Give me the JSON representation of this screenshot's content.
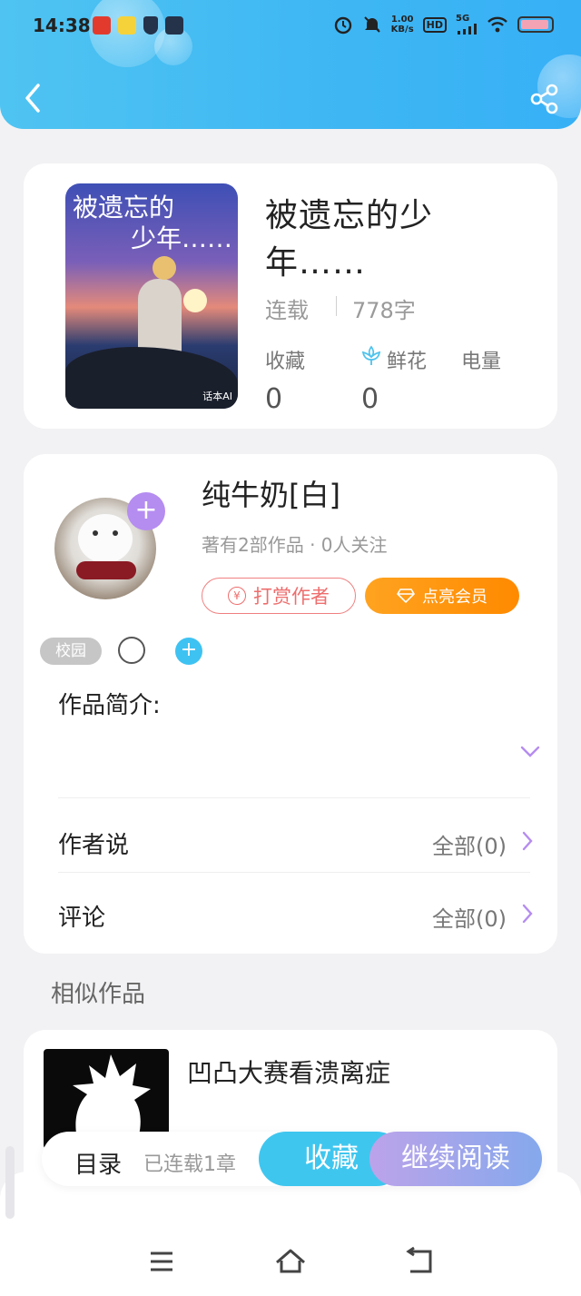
{
  "status_bar": {
    "time": "14:38",
    "net_speed_top": "1.00",
    "net_speed_unit": "KB/s",
    "hd": "HD",
    "signal": "5G"
  },
  "book": {
    "cover_title_line1": "被遗忘的",
    "cover_title_line2": "少年……",
    "cover_watermark": "话本AI",
    "title": "被遗忘的少年……",
    "status": "连载",
    "word_count": "778字",
    "stats": [
      {
        "label": "收藏",
        "value": "0"
      },
      {
        "label": "鲜花",
        "value": "0"
      },
      {
        "label": "电量",
        "value": ""
      }
    ]
  },
  "author": {
    "name": "纯牛奶[白]",
    "meta": "著有2部作品 · 0人关注",
    "reward_label": "打赏作者",
    "vip_label": "点亮会员",
    "tag": "校园"
  },
  "sections": {
    "intro_label": "作品简介:",
    "author_says_label": "作者说",
    "author_says_right": "全部(0)",
    "comments_label": "评论",
    "comments_right": "全部(0)"
  },
  "similar": {
    "heading": "相似作品",
    "items": [
      {
        "title": "凹凸大赛看溃离症"
      }
    ]
  },
  "bottom_bar": {
    "catalog_label": "目录",
    "chapters_label": "已连载1章",
    "favorite_label": "收藏",
    "read_label": "继续阅读"
  },
  "colors": {
    "header_blue": "#3fb7f3",
    "accent_purple": "#b58cf0",
    "reward_red": "#ee6e6e",
    "vip_orange": "#ff8a00",
    "fav_cyan": "#3fc6ef"
  }
}
